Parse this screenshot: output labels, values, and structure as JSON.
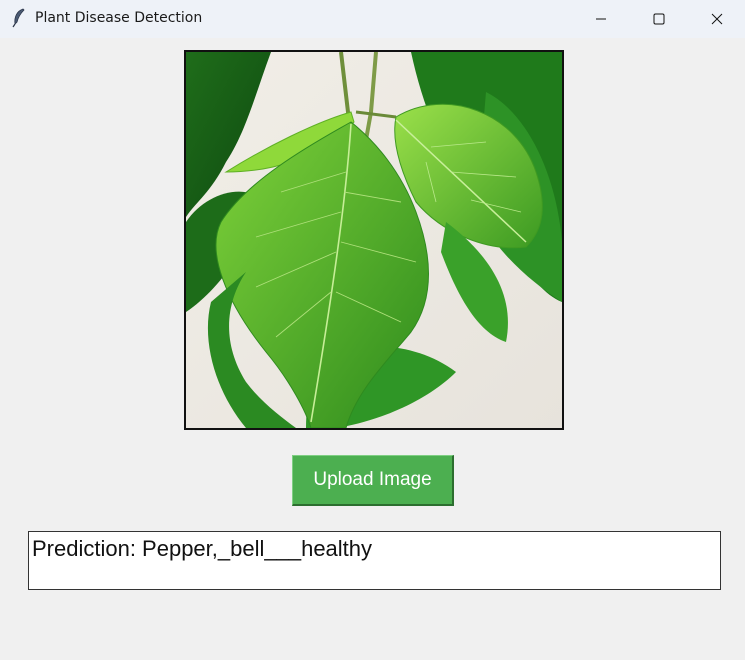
{
  "window": {
    "title": "Plant Disease Detection",
    "icon": "feather-icon",
    "controls": [
      "minimize-icon",
      "maximize-icon",
      "close-icon"
    ]
  },
  "main": {
    "image": {
      "subject": "green leaves photo",
      "kind": "uploaded-image"
    },
    "upload_button_label": "Upload Image",
    "prediction_text": "Prediction: Pepper,_bell___healthy"
  },
  "colors": {
    "button_bg": "#4caf50",
    "button_text": "#ffffff",
    "window_bg": "#f0f0f0",
    "titlebar_bg": "#eef2f8"
  }
}
